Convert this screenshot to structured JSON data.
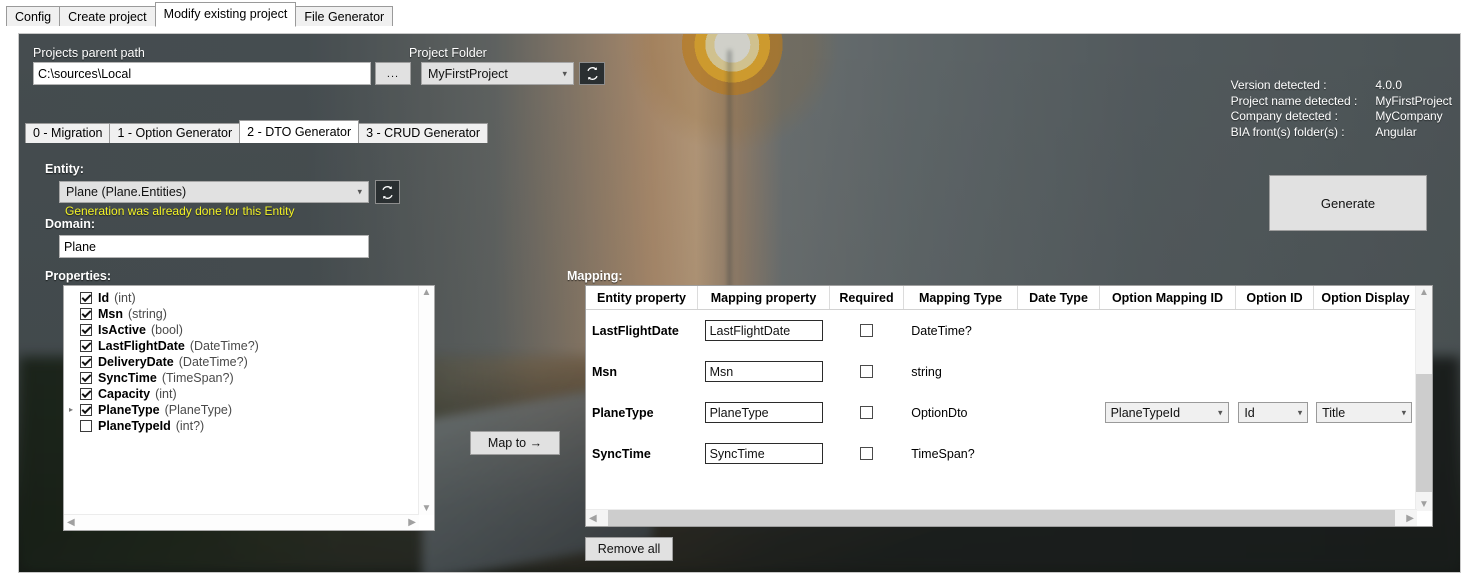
{
  "outer_tabs": [
    {
      "label": "Config",
      "selected": false
    },
    {
      "label": "Create project",
      "selected": false
    },
    {
      "label": "Modify existing project",
      "selected": true
    },
    {
      "label": "File Generator",
      "selected": false
    }
  ],
  "header": {
    "parent_path_label": "Projects parent path",
    "parent_path_value": "C:\\sources\\Local",
    "browse_label": "...",
    "project_folder_label": "Project Folder",
    "project_folder_value": "MyFirstProject",
    "refresh_icon": "refresh-icon",
    "info": [
      {
        "key": "Version detected :",
        "value": "4.0.0"
      },
      {
        "key": "Project name detected :",
        "value": "MyFirstProject"
      },
      {
        "key": "Company detected :",
        "value": "MyCompany"
      },
      {
        "key": "BIA front(s) folder(s) :",
        "value": "Angular"
      }
    ]
  },
  "inner_tabs": [
    {
      "label": "0 - Migration",
      "selected": false
    },
    {
      "label": "1 - Option Generator",
      "selected": false
    },
    {
      "label": "2 - DTO Generator",
      "selected": true
    },
    {
      "label": "3 - CRUD Generator",
      "selected": false
    }
  ],
  "entity": {
    "label": "Entity:",
    "value": "Plane (Plane.Entities)",
    "refresh_icon": "refresh-icon",
    "warning": "Generation was already done for this Entity",
    "warning_color": "#f2f226",
    "domain_label": "Domain:",
    "domain_value": "Plane"
  },
  "generate_button": "Generate",
  "map_to_button": "Map to →",
  "remove_all_button": "Remove all",
  "properties": {
    "label": "Properties:",
    "items": [
      {
        "name": "Id",
        "type": "(int)",
        "checked": true,
        "expandable": false
      },
      {
        "name": "Msn",
        "type": "(string)",
        "checked": true,
        "expandable": false
      },
      {
        "name": "IsActive",
        "type": "(bool)",
        "checked": true,
        "expandable": false
      },
      {
        "name": "LastFlightDate",
        "type": "(DateTime?)",
        "checked": true,
        "expandable": false
      },
      {
        "name": "DeliveryDate",
        "type": "(DateTime?)",
        "checked": true,
        "expandable": false
      },
      {
        "name": "SyncTime",
        "type": "(TimeSpan?)",
        "checked": true,
        "expandable": false
      },
      {
        "name": "Capacity",
        "type": "(int)",
        "checked": true,
        "expandable": false
      },
      {
        "name": "PlaneType",
        "type": "(PlaneType)",
        "checked": true,
        "expandable": true
      },
      {
        "name": "PlaneTypeId",
        "type": "(int?)",
        "checked": false,
        "expandable": false
      }
    ]
  },
  "mapping": {
    "label": "Mapping:",
    "columns": [
      "Entity property",
      "Mapping property",
      "Required",
      "Mapping Type",
      "Date Type",
      "Option Mapping ID",
      "Option ID",
      "Option Display"
    ],
    "rows": [
      {
        "entity_property": "LastFlightDate",
        "mapping_property": "LastFlightDate",
        "required": false,
        "mapping_type": "DateTime?",
        "date_type": "",
        "option_mapping_id": "",
        "option_id": "",
        "option_display": ""
      },
      {
        "entity_property": "Msn",
        "mapping_property": "Msn",
        "required": false,
        "mapping_type": "string",
        "date_type": "",
        "option_mapping_id": "",
        "option_id": "",
        "option_display": ""
      },
      {
        "entity_property": "PlaneType",
        "mapping_property": "PlaneType",
        "required": false,
        "mapping_type": "OptionDto",
        "date_type": "",
        "option_mapping_id": "PlaneTypeId",
        "option_id": "Id",
        "option_display": "Title"
      },
      {
        "entity_property": "SyncTime",
        "mapping_property": "SyncTime",
        "required": false,
        "mapping_type": "TimeSpan?",
        "date_type": "",
        "option_mapping_id": "",
        "option_id": "",
        "option_display": ""
      }
    ]
  }
}
